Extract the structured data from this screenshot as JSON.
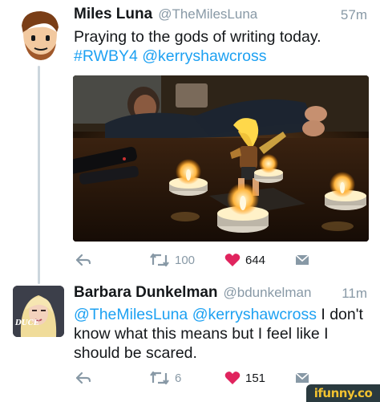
{
  "tweet1": {
    "name": "Miles Luna",
    "handle": "@TheMilesLuna",
    "time": "57m",
    "text_line1": "Praying to the gods of writing today.",
    "hashtag": "#RWBY4",
    "mention": "@kerryshawcross",
    "retweets": "100",
    "likes": "644"
  },
  "tweet2": {
    "name": "Barbara Dunkelman",
    "handle": "@bdunkelman",
    "time": "11m",
    "mention1": "@TheMilesLuna",
    "mention2": "@kerryshawcross",
    "text_after_mentions": "I don't",
    "text_line2": "know what this means but I feel like I",
    "text_line3": "should be scared.",
    "retweets": "6",
    "likes": "151",
    "avatar_overlay_text": "DUCE"
  },
  "watermark": "ifunny.co",
  "colors": {
    "link": "#1da1f2",
    "like": "#e0245e",
    "muted": "#8899a6"
  },
  "icons": [
    "reply-icon",
    "retweet-icon",
    "heart-icon",
    "direct-message-icon"
  ]
}
